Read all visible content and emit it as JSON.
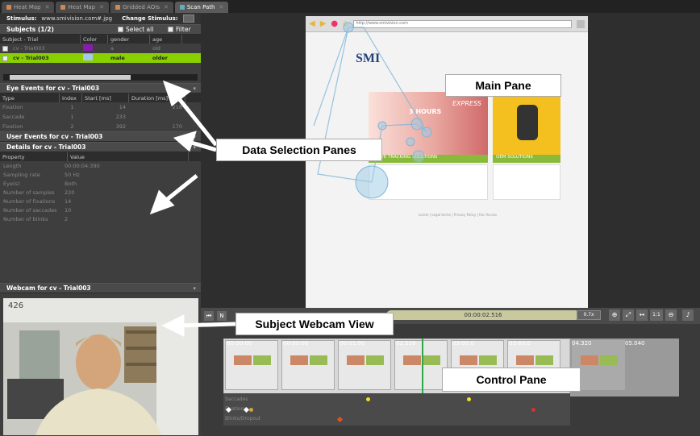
{
  "tabs": [
    {
      "label": "Heat Map",
      "active": false
    },
    {
      "label": "Heat Map",
      "active": false
    },
    {
      "label": "Gridded AOIs",
      "active": false
    },
    {
      "label": "Scan Path",
      "active": true
    }
  ],
  "stimulus": {
    "label": "Stimulus:",
    "value": "www.smivision.com#.jpg",
    "change_label": "Change Stimulus:"
  },
  "subjects": {
    "title": "Subjects (1/2)",
    "select_all": "Select all",
    "filter": "Filter",
    "columns": [
      "Subject - Trial",
      "Color",
      "gender",
      "age"
    ],
    "rows": [
      {
        "name": "cv - Trial003",
        "color": "#8a1bb0",
        "gender": "a",
        "age": "old",
        "selected": false
      },
      {
        "name": "cv - Trial003",
        "color": "#a8c8e8",
        "gender": "male",
        "age": "older",
        "selected": true
      }
    ]
  },
  "eye_events": {
    "title": "Eye Events for cv - Trial003",
    "columns": [
      "Type",
      "Index",
      "Start [ms]",
      "Duration [ms]"
    ],
    "rows": [
      {
        "type": "Fixation",
        "index": "1",
        "start": "14",
        "duration": "218"
      },
      {
        "type": "Saccade",
        "index": "1",
        "start": "233",
        "duration": ""
      },
      {
        "type": "Fixation",
        "index": "2",
        "start": "392",
        "duration": "170"
      }
    ]
  },
  "user_events": {
    "title": "User Events for cv - Trial003"
  },
  "details": {
    "title": "Details for cv - Trial003",
    "columns": [
      "Property",
      "Value"
    ],
    "rows": [
      {
        "k": "Length",
        "v": "00:00:04:390"
      },
      {
        "k": "Sampling rate",
        "v": "50 Hz"
      },
      {
        "k": "Eye(s)",
        "v": "Both"
      },
      {
        "k": "Number of samples",
        "v": "220"
      },
      {
        "k": "Number of fixations",
        "v": "14"
      },
      {
        "k": "Number of saccades",
        "v": "10"
      },
      {
        "k": "Number of blinks",
        "v": "2"
      }
    ]
  },
  "webcam": {
    "title": "Webcam for cv - Trial003",
    "counter": "426"
  },
  "browser": {
    "url": "http://www.smivision.com",
    "logo": "SMI",
    "promo_left": "3 HOURS",
    "promo_right": "EXPRESS",
    "caption_left": "EYE TRACKING SOLUTIONS",
    "caption_right": "OEM SOLUTIONS",
    "footer": "Lorem | Legal terms | Privacy Policy | Fair Access"
  },
  "control": {
    "time": "00:00:02.516",
    "speed": "0.7x",
    "zoom": "1:1",
    "timeline_labels": [
      "00:00:00",
      "00:00:00",
      "00:01:90",
      "02.516",
      "03:00:0",
      "03:60:0",
      "04.320",
      "05.040"
    ],
    "rows": [
      "Saccades",
      "Fixations",
      "Blinks/Dropout"
    ]
  },
  "callouts": {
    "main": "Main Pane",
    "data": "Data Selection Panes",
    "webcam": "Subject Webcam View",
    "control": "Control Pane"
  }
}
